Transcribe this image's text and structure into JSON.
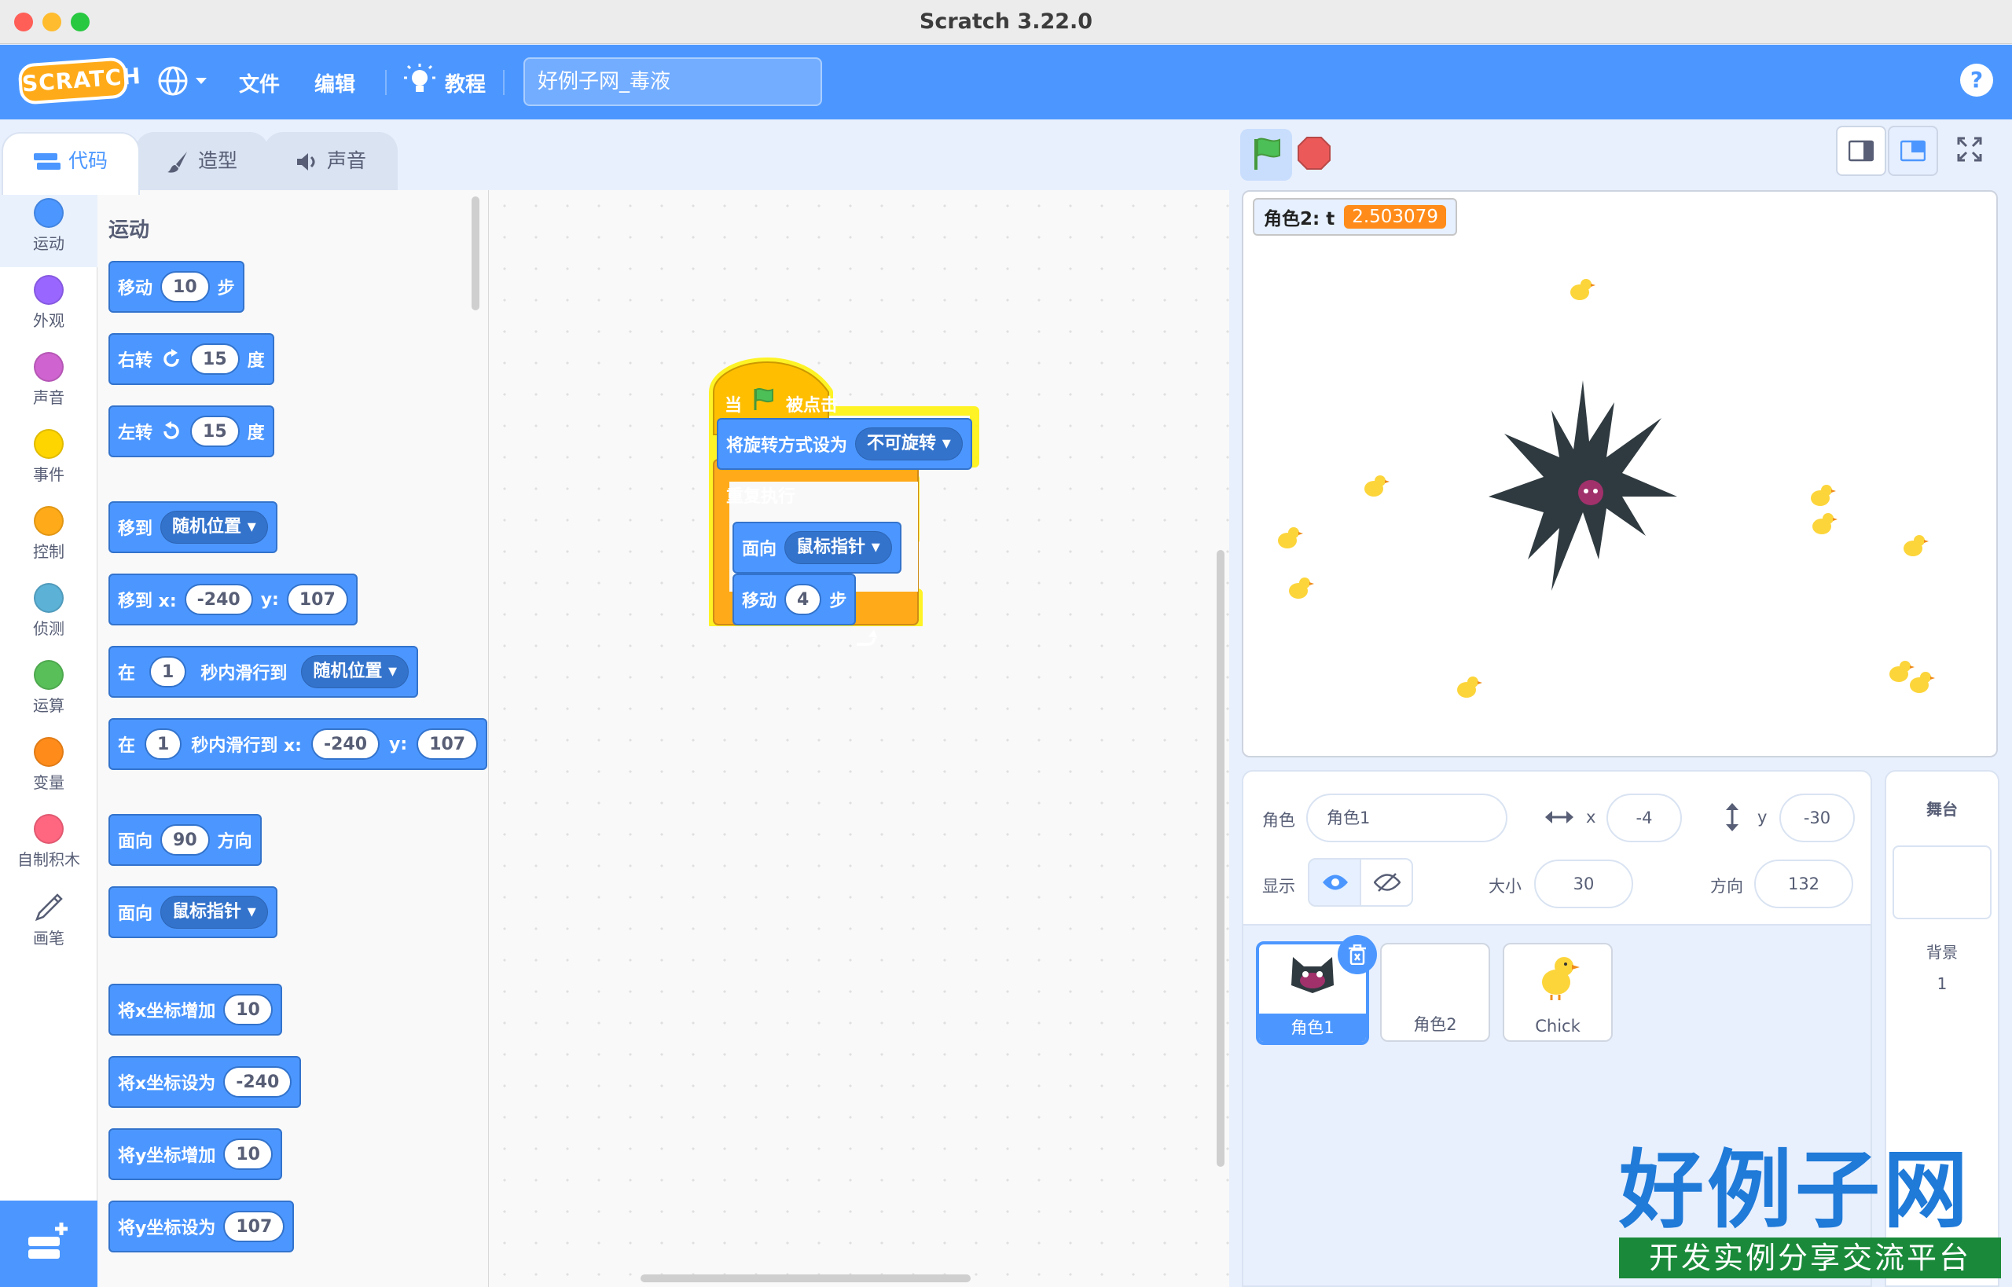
{
  "window": {
    "title": "Scratch 3.22.0"
  },
  "menu": {
    "logo": "SCRATCH",
    "file": "文件",
    "edit": "编辑",
    "tutorials": "教程",
    "project_title": "好例子网_毒液",
    "help": "?"
  },
  "tabs": [
    {
      "label": "代码"
    },
    {
      "label": "造型"
    },
    {
      "label": "声音"
    }
  ],
  "categories": [
    {
      "label": "运动",
      "color": "#4c97ff"
    },
    {
      "label": "外观",
      "color": "#9966ff"
    },
    {
      "label": "声音",
      "color": "#cf63cf"
    },
    {
      "label": "事件",
      "color": "#ffd500"
    },
    {
      "label": "控制",
      "color": "#ffab19"
    },
    {
      "label": "侦测",
      "color": "#5cb1d6"
    },
    {
      "label": "运算",
      "color": "#59c059"
    },
    {
      "label": "变量",
      "color": "#ff8c1a"
    },
    {
      "label": "自制积木",
      "color": "#ff6680"
    },
    {
      "label": "画笔",
      "color": "#0fbd8c"
    }
  ],
  "palette": {
    "heading": "运动",
    "move": {
      "label": "移动",
      "value": "10",
      "suffix": "步"
    },
    "turn_right": {
      "label": "右转",
      "value": "15",
      "suffix": "度"
    },
    "turn_left": {
      "label": "左转",
      "value": "15",
      "suffix": "度"
    },
    "goto": {
      "label": "移到",
      "dropdown": "随机位置"
    },
    "goto_xy": {
      "label": "移到 x:",
      "x": "-240",
      "ylabel": "y:",
      "y": "107"
    },
    "glide": {
      "label": "在",
      "secs": "1",
      "mid": "秒内滑行到",
      "dropdown": "随机位置"
    },
    "glide_xy": {
      "label": "在",
      "secs": "1",
      "mid": "秒内滑行到 x:",
      "x": "-240",
      "ylabel": "y:",
      "y": "107"
    },
    "point_dir": {
      "label": "面向",
      "value": "90",
      "suffix": "方向"
    },
    "point_towards": {
      "label": "面向",
      "dropdown": "鼠标指针"
    },
    "change_x": {
      "label": "将x坐标增加",
      "value": "10"
    },
    "set_x": {
      "label": "将x坐标设为",
      "value": "-240"
    },
    "change_y": {
      "label": "将y坐标增加",
      "value": "10"
    },
    "set_y": {
      "label": "将y坐标设为",
      "value": "107"
    }
  },
  "script": {
    "hat_pre": "当",
    "hat_post": "被点击",
    "rotation": {
      "label": "将旋转方式设为",
      "dropdown": "不可旋转"
    },
    "forever": "重复执行",
    "point": {
      "label": "面向",
      "dropdown": "鼠标指针"
    },
    "move": {
      "label": "移动",
      "value": "4",
      "suffix": "步"
    }
  },
  "zoom": {
    "in": "+",
    "out": "−",
    "reset": "="
  },
  "stage": {
    "monitor_label": "角色2: t",
    "monitor_value": "2.503079"
  },
  "sprite_info": {
    "sprite_label": "角色",
    "sprite_name": "角色1",
    "x_label": "x",
    "x": "-4",
    "y_label": "y",
    "y": "-30",
    "show_label": "显示",
    "size_label": "大小",
    "size": "30",
    "direction_label": "方向",
    "direction": "132"
  },
  "sprites": [
    {
      "name": "角色1"
    },
    {
      "name": "角色2"
    },
    {
      "name": "Chick"
    }
  ],
  "stage_panel": {
    "title": "舞台",
    "backdrop_label": "背景",
    "backdrop_count": "1"
  },
  "watermark": {
    "title": "好例子网",
    "subtitle": "开发实例分享交流平台"
  }
}
